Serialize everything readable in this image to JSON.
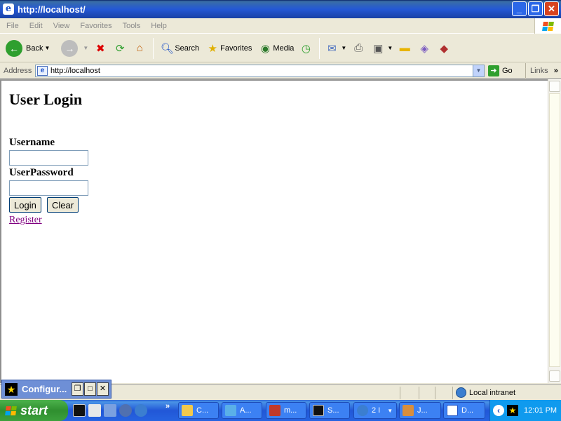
{
  "window": {
    "title": "http://localhost/",
    "icon_glyph": "e"
  },
  "menu": [
    "File",
    "Edit",
    "View",
    "Favorites",
    "Tools",
    "Help"
  ],
  "toolbar": {
    "back_label": "Back",
    "search_label": "Search",
    "favorites_label": "Favorites",
    "media_label": "Media"
  },
  "address": {
    "label": "Address",
    "url": "http://localhost",
    "go_label": "Go",
    "links_label": "Links"
  },
  "page": {
    "heading": "User Login",
    "username_label": "Username",
    "username_value": "",
    "password_label": "UserPassword",
    "password_value": "",
    "login_button": "Login",
    "clear_button": "Clear",
    "register_link": "Register"
  },
  "status": {
    "zone": "Local intranet"
  },
  "mini_window": {
    "title": "Configur..."
  },
  "taskbar": {
    "start_label": "start",
    "tasks": [
      {
        "label": "C...",
        "icon": "folder-icon"
      },
      {
        "label": "A...",
        "icon": "app-icon"
      },
      {
        "label": "m...",
        "icon": "app-icon"
      },
      {
        "label": "S...",
        "icon": "console-icon"
      },
      {
        "label": "2 I",
        "icon": "ie-icon"
      },
      {
        "label": "J...",
        "icon": "paint-icon"
      },
      {
        "label": "D...",
        "icon": "word-icon"
      }
    ],
    "clock": "12:01 PM"
  },
  "colors": {
    "titlebar": "#2458D5",
    "taskbar": "#2157D7",
    "start_green": "#3CA03C",
    "visited_link": "#800080"
  }
}
